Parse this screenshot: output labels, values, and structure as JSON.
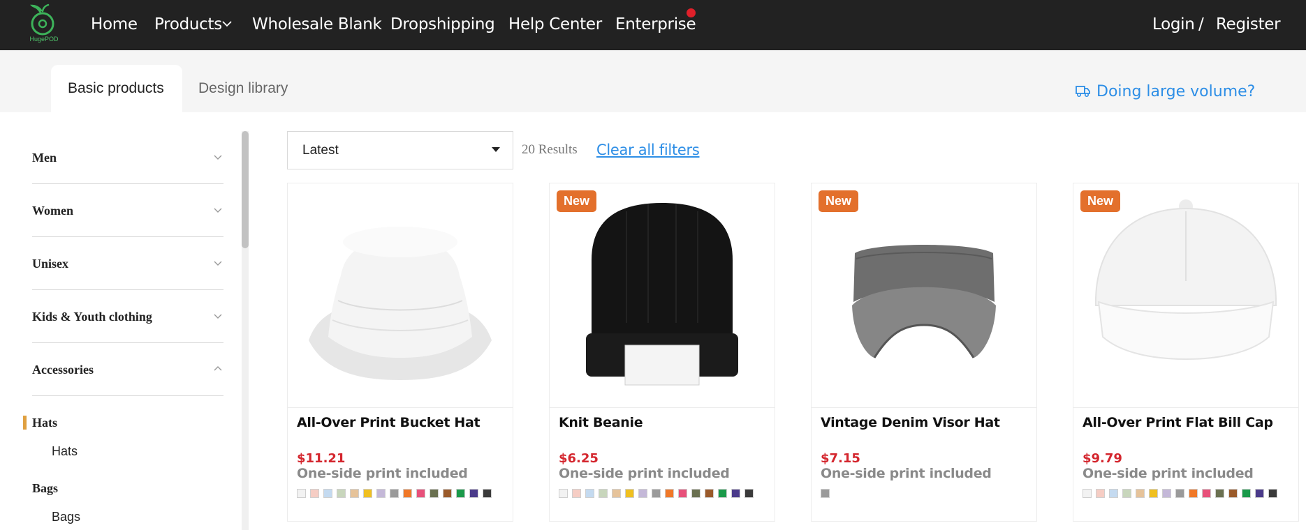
{
  "brand": {
    "name": "HugePOD",
    "color": "#3db35a"
  },
  "nav": {
    "items": [
      {
        "label": "Home"
      },
      {
        "label": "Products"
      },
      {
        "label": "Wholesale Blank"
      },
      {
        "label": "Dropshipping"
      },
      {
        "label": "Help Center"
      },
      {
        "label": "Enterprise"
      }
    ],
    "login": "Login",
    "separator": "/",
    "register": "Register"
  },
  "tabs": {
    "items": [
      {
        "label": "Basic products",
        "active": true
      },
      {
        "label": "Design library",
        "active": false
      }
    ],
    "volume_link": "Doing large volume?"
  },
  "sidebar": {
    "categories": [
      {
        "label": "Men",
        "expanded": false
      },
      {
        "label": "Women",
        "expanded": false
      },
      {
        "label": "Unisex",
        "expanded": false
      },
      {
        "label": "Kids & Youth clothing",
        "expanded": false
      },
      {
        "label": "Accessories",
        "expanded": true
      }
    ],
    "subgroups": [
      {
        "label": "Hats",
        "selected": true,
        "items": [
          "Hats"
        ]
      },
      {
        "label": "Bags",
        "selected": false,
        "items": [
          "Bags"
        ]
      }
    ]
  },
  "filters": {
    "sort": "Latest",
    "results": "20 Results",
    "clear": "Clear all filters"
  },
  "swatch_palette": [
    "#f2f2f2",
    "#f6cdc4",
    "#c4daf0",
    "#c8d6bc",
    "#e6c39a",
    "#f0c020",
    "#c4b8d8",
    "#9a9a9a",
    "#f07828",
    "#e8507a",
    "#6a7050",
    "#9a5a2a",
    "#1a9a4a",
    "#4a3a8a",
    "#3a3a3a"
  ],
  "products": [
    {
      "name": "All-Over Print Bucket Hat",
      "price": "$11.21",
      "note": "One-side print included",
      "badge": "",
      "swatches": "all"
    },
    {
      "name": "Knit Beanie",
      "price": "$6.25",
      "note": "One-side print included",
      "badge": "New",
      "swatches": "all"
    },
    {
      "name": "Vintage Denim Visor Hat",
      "price": "$7.15",
      "note": "One-side print included",
      "badge": "New",
      "swatches": [
        "#9a9a9a"
      ]
    },
    {
      "name": "All-Over Print Flat Bill Cap",
      "price": "$9.79",
      "note": "One-side print included",
      "badge": "New",
      "swatches": "all"
    }
  ]
}
